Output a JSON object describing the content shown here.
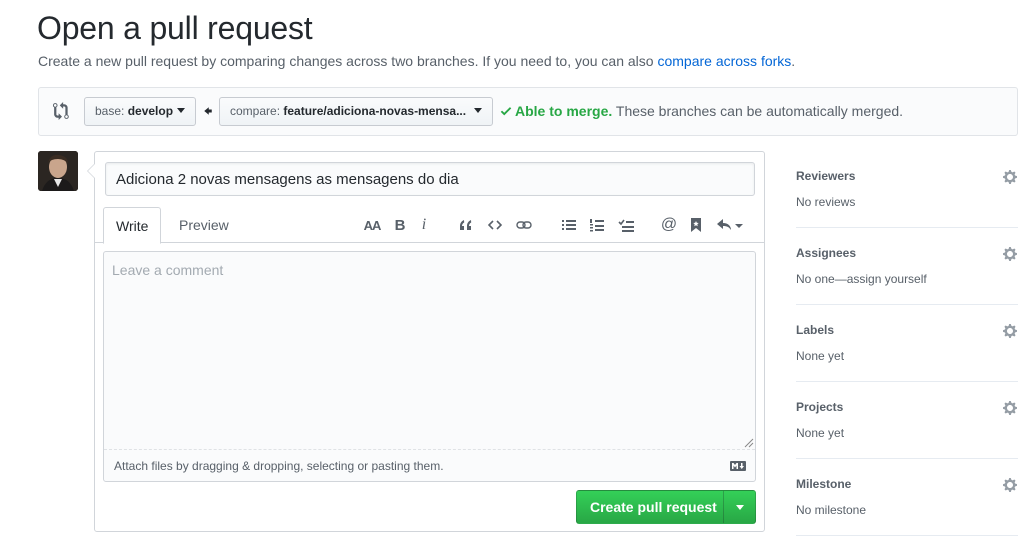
{
  "header": {
    "title": "Open a pull request",
    "subtitle_prefix": "Create a new pull request by comparing changes across two branches. If you need to, you can also ",
    "subtitle_link": "compare across forks",
    "subtitle_suffix": "."
  },
  "range": {
    "base_prefix": "base: ",
    "base_branch": "develop",
    "compare_prefix": "compare: ",
    "compare_branch": "feature/adiciona-novas-mensa...",
    "merge_status": "Able to merge.",
    "merge_detail": " These branches can be automatically merged."
  },
  "form": {
    "title_value": "Adiciona 2 novas mensagens as mensagens do dia",
    "tabs": [
      "Write",
      "Preview"
    ],
    "toolbar_icons": [
      "text-size-icon",
      "bold-icon",
      "italic-icon",
      "quote-icon",
      "code-icon",
      "link-icon",
      "unordered-list-icon",
      "ordered-list-icon",
      "task-list-icon",
      "mention-icon",
      "saved-reply-icon",
      "reply-icon"
    ],
    "toolbar_text": {
      "heading": "AA",
      "bold": "B",
      "italic": "i",
      "mention": "@"
    },
    "comment_placeholder": "Leave a comment",
    "attach_text": "Attach files by dragging & dropping, selecting or pasting them.",
    "submit_label": "Create pull request"
  },
  "sidebar": [
    {
      "heading": "Reviewers",
      "value": "No reviews"
    },
    {
      "heading": "Assignees",
      "value": "No one—assign yourself"
    },
    {
      "heading": "Labels",
      "value": "None yet"
    },
    {
      "heading": "Projects",
      "value": "None yet"
    },
    {
      "heading": "Milestone",
      "value": "No milestone"
    }
  ],
  "colors": {
    "link": "#0366d6",
    "success": "#28a745",
    "button_green": "#2ea44f",
    "muted_text": "#586069"
  }
}
